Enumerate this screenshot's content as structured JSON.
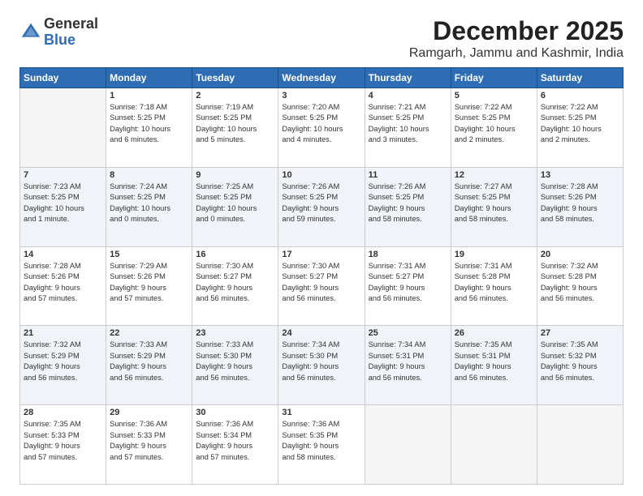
{
  "logo": {
    "general": "General",
    "blue": "Blue"
  },
  "header": {
    "title": "December 2025",
    "subtitle": "Ramgarh, Jammu and Kashmir, India"
  },
  "days_of_week": [
    "Sunday",
    "Monday",
    "Tuesday",
    "Wednesday",
    "Thursday",
    "Friday",
    "Saturday"
  ],
  "weeks": [
    [
      {
        "day": "",
        "info": ""
      },
      {
        "day": "1",
        "info": "Sunrise: 7:18 AM\nSunset: 5:25 PM\nDaylight: 10 hours\nand 6 minutes."
      },
      {
        "day": "2",
        "info": "Sunrise: 7:19 AM\nSunset: 5:25 PM\nDaylight: 10 hours\nand 5 minutes."
      },
      {
        "day": "3",
        "info": "Sunrise: 7:20 AM\nSunset: 5:25 PM\nDaylight: 10 hours\nand 4 minutes."
      },
      {
        "day": "4",
        "info": "Sunrise: 7:21 AM\nSunset: 5:25 PM\nDaylight: 10 hours\nand 3 minutes."
      },
      {
        "day": "5",
        "info": "Sunrise: 7:22 AM\nSunset: 5:25 PM\nDaylight: 10 hours\nand 2 minutes."
      },
      {
        "day": "6",
        "info": "Sunrise: 7:22 AM\nSunset: 5:25 PM\nDaylight: 10 hours\nand 2 minutes."
      }
    ],
    [
      {
        "day": "7",
        "info": "Sunrise: 7:23 AM\nSunset: 5:25 PM\nDaylight: 10 hours\nand 1 minute."
      },
      {
        "day": "8",
        "info": "Sunrise: 7:24 AM\nSunset: 5:25 PM\nDaylight: 10 hours\nand 0 minutes."
      },
      {
        "day": "9",
        "info": "Sunrise: 7:25 AM\nSunset: 5:25 PM\nDaylight: 10 hours\nand 0 minutes."
      },
      {
        "day": "10",
        "info": "Sunrise: 7:26 AM\nSunset: 5:25 PM\nDaylight: 9 hours\nand 59 minutes."
      },
      {
        "day": "11",
        "info": "Sunrise: 7:26 AM\nSunset: 5:25 PM\nDaylight: 9 hours\nand 58 minutes."
      },
      {
        "day": "12",
        "info": "Sunrise: 7:27 AM\nSunset: 5:25 PM\nDaylight: 9 hours\nand 58 minutes."
      },
      {
        "day": "13",
        "info": "Sunrise: 7:28 AM\nSunset: 5:26 PM\nDaylight: 9 hours\nand 58 minutes."
      }
    ],
    [
      {
        "day": "14",
        "info": "Sunrise: 7:28 AM\nSunset: 5:26 PM\nDaylight: 9 hours\nand 57 minutes."
      },
      {
        "day": "15",
        "info": "Sunrise: 7:29 AM\nSunset: 5:26 PM\nDaylight: 9 hours\nand 57 minutes."
      },
      {
        "day": "16",
        "info": "Sunrise: 7:30 AM\nSunset: 5:27 PM\nDaylight: 9 hours\nand 56 minutes."
      },
      {
        "day": "17",
        "info": "Sunrise: 7:30 AM\nSunset: 5:27 PM\nDaylight: 9 hours\nand 56 minutes."
      },
      {
        "day": "18",
        "info": "Sunrise: 7:31 AM\nSunset: 5:27 PM\nDaylight: 9 hours\nand 56 minutes."
      },
      {
        "day": "19",
        "info": "Sunrise: 7:31 AM\nSunset: 5:28 PM\nDaylight: 9 hours\nand 56 minutes."
      },
      {
        "day": "20",
        "info": "Sunrise: 7:32 AM\nSunset: 5:28 PM\nDaylight: 9 hours\nand 56 minutes."
      }
    ],
    [
      {
        "day": "21",
        "info": "Sunrise: 7:32 AM\nSunset: 5:29 PM\nDaylight: 9 hours\nand 56 minutes."
      },
      {
        "day": "22",
        "info": "Sunrise: 7:33 AM\nSunset: 5:29 PM\nDaylight: 9 hours\nand 56 minutes."
      },
      {
        "day": "23",
        "info": "Sunrise: 7:33 AM\nSunset: 5:30 PM\nDaylight: 9 hours\nand 56 minutes."
      },
      {
        "day": "24",
        "info": "Sunrise: 7:34 AM\nSunset: 5:30 PM\nDaylight: 9 hours\nand 56 minutes."
      },
      {
        "day": "25",
        "info": "Sunrise: 7:34 AM\nSunset: 5:31 PM\nDaylight: 9 hours\nand 56 minutes."
      },
      {
        "day": "26",
        "info": "Sunrise: 7:35 AM\nSunset: 5:31 PM\nDaylight: 9 hours\nand 56 minutes."
      },
      {
        "day": "27",
        "info": "Sunrise: 7:35 AM\nSunset: 5:32 PM\nDaylight: 9 hours\nand 56 minutes."
      }
    ],
    [
      {
        "day": "28",
        "info": "Sunrise: 7:35 AM\nSunset: 5:33 PM\nDaylight: 9 hours\nand 57 minutes."
      },
      {
        "day": "29",
        "info": "Sunrise: 7:36 AM\nSunset: 5:33 PM\nDaylight: 9 hours\nand 57 minutes."
      },
      {
        "day": "30",
        "info": "Sunrise: 7:36 AM\nSunset: 5:34 PM\nDaylight: 9 hours\nand 57 minutes."
      },
      {
        "day": "31",
        "info": "Sunrise: 7:36 AM\nSunset: 5:35 PM\nDaylight: 9 hours\nand 58 minutes."
      },
      {
        "day": "",
        "info": ""
      },
      {
        "day": "",
        "info": ""
      },
      {
        "day": "",
        "info": ""
      }
    ]
  ]
}
